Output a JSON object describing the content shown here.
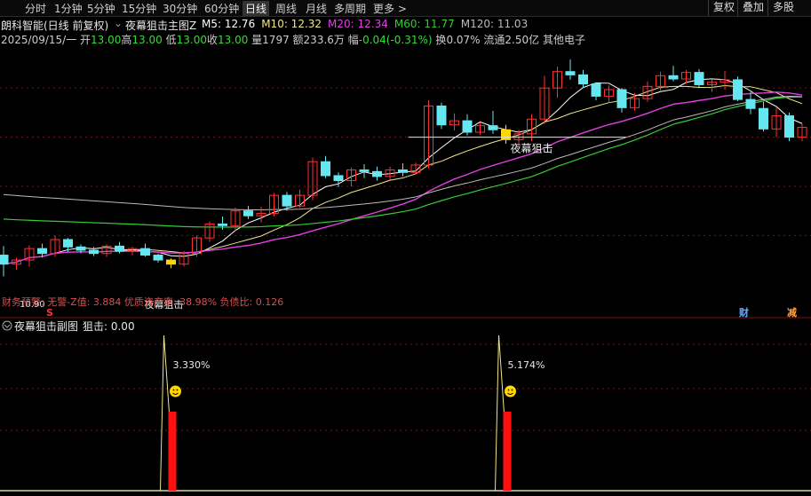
{
  "toolbar": {
    "periods": [
      {
        "label": "分时",
        "active": false
      },
      {
        "label": "1分钟",
        "active": false
      },
      {
        "label": "5分钟",
        "active": false
      },
      {
        "label": "15分钟",
        "active": false
      },
      {
        "label": "30分钟",
        "active": false
      },
      {
        "label": "60分钟",
        "active": false
      },
      {
        "label": "日线",
        "active": true
      },
      {
        "label": "周线",
        "active": false
      },
      {
        "label": "月线",
        "active": false
      },
      {
        "label": "多周期",
        "active": false
      },
      {
        "label": "更多 >",
        "active": false
      }
    ],
    "right_buttons": [
      "复权",
      "叠加",
      "多股"
    ]
  },
  "title_bar": {
    "stock_label": "朗科智能(日线 前复权)",
    "indicator_name": "夜幕狙击主图Z",
    "ma": [
      {
        "label": "M5:",
        "value": "12.76",
        "color": "#ffffff"
      },
      {
        "label": "M10:",
        "value": "12.32",
        "color": "#f0e68c"
      },
      {
        "label": "M20:",
        "value": "12.34",
        "color": "#e040e0"
      },
      {
        "label": "M60:",
        "value": "11.77",
        "color": "#33cc33"
      },
      {
        "label": "M120:",
        "value": "11.03",
        "color": "#bbbbbb"
      }
    ]
  },
  "quote_bar": {
    "date": "2025/09/15/一",
    "open_label": "开",
    "open": "13.00",
    "high_label": "高",
    "high": "13.00",
    "low_label": "低",
    "low": "13.00",
    "close_label": "收",
    "close": "13.00",
    "vol_label": "量",
    "vol": "1797",
    "amount_label": "额",
    "amount": "233.6万",
    "change_label": "幅",
    "change": "-0.04(-0.31%)",
    "turnover_label": "换",
    "turnover": "0.07%",
    "float_label": "流通",
    "float": "2.50亿",
    "sector": "其他电子"
  },
  "main_chart": {
    "signal_label": "夜幕狙击",
    "finance_text": "财务预警: 无警-Z值: 3.884 优质资产率: 38.98%  负债比: 0.126",
    "low_price_label": "10.90",
    "markers": [
      "S",
      "财",
      "减"
    ],
    "colors": {
      "up": "#ff3030",
      "down": "#66e6f0",
      "signal": "#ffd700"
    },
    "ohlc": [
      [
        11.16,
        11.27,
        10.9,
        11.05
      ],
      [
        11.05,
        11.13,
        10.98,
        11.1
      ],
      [
        11.1,
        11.28,
        11.02,
        11.24
      ],
      [
        11.24,
        11.3,
        11.13,
        11.18
      ],
      [
        11.18,
        11.4,
        11.14,
        11.35
      ],
      [
        11.35,
        11.37,
        11.2,
        11.26
      ],
      [
        11.26,
        11.29,
        11.18,
        11.22
      ],
      [
        11.22,
        11.26,
        11.15,
        11.18
      ],
      [
        11.18,
        11.29,
        11.14,
        11.27
      ],
      [
        11.27,
        11.32,
        11.18,
        11.21
      ],
      [
        11.21,
        11.26,
        11.16,
        11.24
      ],
      [
        11.24,
        11.3,
        11.14,
        11.16
      ],
      [
        11.16,
        11.18,
        11.07,
        11.1
      ],
      [
        11.1,
        11.12,
        11.0,
        11.05
      ],
      [
        11.05,
        11.21,
        11.02,
        11.18
      ],
      [
        11.18,
        11.4,
        11.14,
        11.37
      ],
      [
        11.37,
        11.57,
        11.32,
        11.54
      ],
      [
        11.54,
        11.63,
        11.47,
        11.52
      ],
      [
        11.52,
        11.74,
        11.46,
        11.7
      ],
      [
        11.7,
        11.76,
        11.6,
        11.64
      ],
      [
        11.64,
        11.75,
        11.56,
        11.67
      ],
      [
        11.67,
        11.92,
        11.63,
        11.89
      ],
      [
        11.89,
        11.93,
        11.7,
        11.76
      ],
      [
        11.76,
        11.96,
        11.74,
        11.89
      ],
      [
        11.89,
        12.35,
        11.83,
        12.3
      ],
      [
        12.3,
        12.37,
        12.1,
        12.13
      ],
      [
        12.13,
        12.17,
        11.99,
        12.07
      ],
      [
        12.07,
        12.23,
        12.0,
        12.2
      ],
      [
        12.2,
        12.27,
        12.1,
        12.18
      ],
      [
        12.18,
        12.24,
        12.07,
        12.12
      ],
      [
        12.12,
        12.24,
        12.08,
        12.2
      ],
      [
        12.2,
        12.28,
        12.12,
        12.17
      ],
      [
        12.17,
        12.29,
        12.14,
        12.26
      ],
      [
        12.26,
        13.05,
        12.22,
        12.98
      ],
      [
        12.98,
        13.02,
        12.7,
        12.75
      ],
      [
        12.75,
        12.89,
        12.68,
        12.8
      ],
      [
        12.8,
        12.88,
        12.62,
        12.66
      ],
      [
        12.66,
        12.78,
        12.63,
        12.74
      ],
      [
        12.74,
        12.92,
        12.64,
        12.69
      ],
      [
        12.69,
        12.75,
        12.52,
        12.57
      ],
      [
        12.57,
        12.69,
        12.5,
        12.64
      ],
      [
        12.64,
        12.88,
        12.55,
        12.82
      ],
      [
        12.82,
        13.35,
        12.76,
        13.2
      ],
      [
        13.2,
        13.46,
        13.08,
        13.4
      ],
      [
        13.4,
        13.55,
        13.3,
        13.36
      ],
      [
        13.36,
        13.42,
        13.2,
        13.25
      ],
      [
        13.25,
        13.27,
        13.05,
        13.1
      ],
      [
        13.1,
        13.23,
        13.02,
        13.18
      ],
      [
        13.18,
        13.2,
        12.9,
        12.96
      ],
      [
        12.96,
        13.14,
        12.92,
        13.07
      ],
      [
        13.07,
        13.28,
        13.03,
        13.22
      ],
      [
        13.22,
        13.4,
        13.17,
        13.35
      ],
      [
        13.35,
        13.47,
        13.28,
        13.31
      ],
      [
        13.31,
        13.42,
        13.25,
        13.39
      ],
      [
        13.39,
        13.43,
        13.2,
        13.24
      ],
      [
        13.24,
        13.3,
        13.15,
        13.27
      ],
      [
        13.27,
        13.41,
        13.18,
        13.3
      ],
      [
        13.3,
        13.34,
        13.04,
        13.06
      ],
      [
        13.06,
        13.15,
        12.88,
        12.95
      ],
      [
        12.95,
        13.03,
        12.67,
        12.7
      ],
      [
        12.7,
        12.96,
        12.6,
        12.86
      ],
      [
        12.86,
        12.9,
        12.55,
        12.6
      ],
      [
        12.6,
        12.76,
        12.55,
        12.72
      ]
    ],
    "signals": [
      13,
      39
    ],
    "y_range": [
      10.7,
      13.7
    ],
    "grid_prices": [
      11.4,
      12.0,
      12.6,
      13.2
    ]
  },
  "sub_chart": {
    "title": "夜幕狙击副图",
    "value_label": "狙击:",
    "value": "0.00",
    "signals": [
      {
        "index": 13,
        "percent": "3.330%"
      },
      {
        "index": 39,
        "percent": "5.174%"
      }
    ]
  }
}
